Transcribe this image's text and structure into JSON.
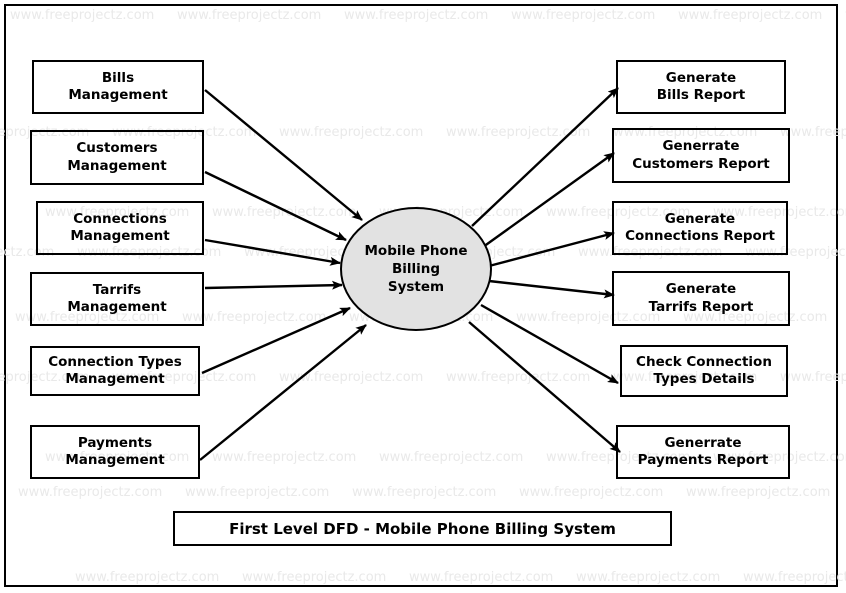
{
  "diagram": {
    "title": "First Level DFD - Mobile Phone Billing System",
    "process": {
      "label": "Mobile Phone\nBilling\nSystem",
      "fill": "#e2e2e2",
      "stroke": "#000000"
    },
    "inputs": [
      {
        "label": "Bills\nManagement"
      },
      {
        "label": "Customers\nManagement"
      },
      {
        "label": "Connections\nManagement"
      },
      {
        "label": "Tarrifs\nManagement"
      },
      {
        "label": "Connection Types\nManagement"
      },
      {
        "label": "Payments\nManagement"
      }
    ],
    "outputs": [
      {
        "label": "Generate\nBills Report"
      },
      {
        "label": "Generrate\nCustomers Report"
      },
      {
        "label": "Generate\nConnections Report"
      },
      {
        "label": "Generate\nTarrifs Report"
      },
      {
        "label": "Check Connection\nTypes Details"
      },
      {
        "label": "Generrate\nPayments Report"
      }
    ]
  },
  "watermark": {
    "text": "www.freeprojectz.com",
    "color": "#e9e9e9"
  }
}
